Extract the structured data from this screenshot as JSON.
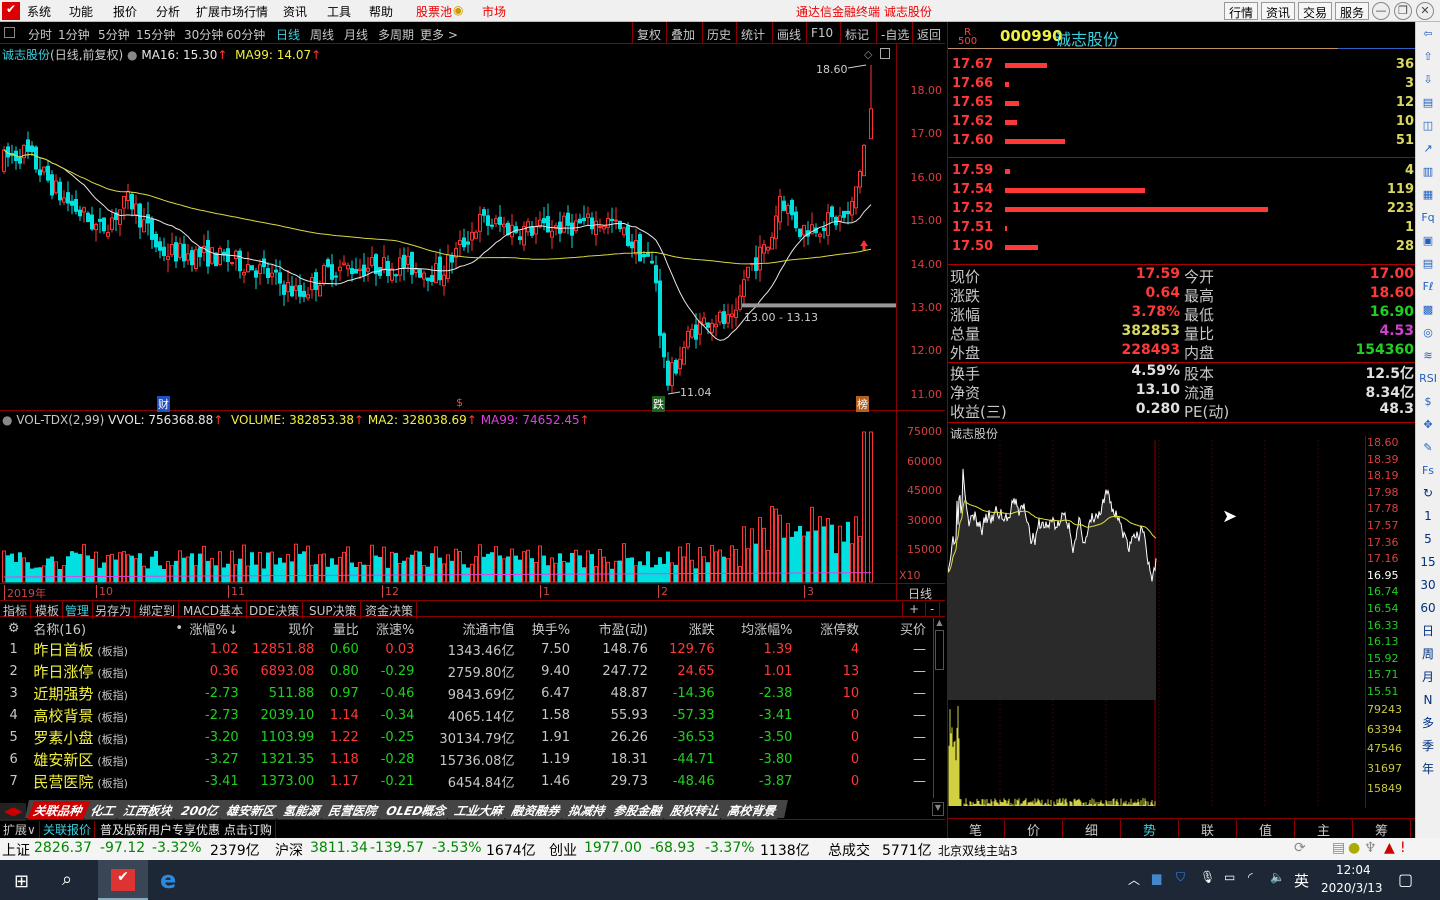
{
  "app": {
    "title": "通达信金融终端 诚志股份",
    "menu": [
      "系统",
      "功能",
      "报价",
      "分析",
      "扩展市场行情",
      "资讯",
      "工具",
      "帮助"
    ],
    "stock_pool": "股票池",
    "market": "市场",
    "top_buttons": [
      "行情",
      "资讯",
      "交易",
      "服务"
    ]
  },
  "periods": {
    "items": [
      "分时",
      "1分钟",
      "5分钟",
      "15分钟",
      "30分钟",
      "60分钟",
      "日线",
      "周线",
      "月线",
      "多周期",
      "更多 >"
    ],
    "selected": "日线"
  },
  "chart_tools": [
    "复权",
    "叠加",
    "历史",
    "统计",
    "画线",
    "F10",
    "标记",
    "-自选",
    "返回"
  ],
  "kline": {
    "name": "诚志股份",
    "mode": "(日线,前复权)",
    "ma16": "MA16: 15.30",
    "ma99": "MA99: 14.07",
    "high_label": "18.60",
    "low_label": "11.04",
    "range_label": "13.00 - 13.13",
    "price_ticks": [
      "18.00",
      "17.00",
      "16.00",
      "15.00",
      "14.00",
      "13.00",
      "12.00",
      "11.00"
    ],
    "markers": [
      "财",
      "$",
      "跌",
      "榜"
    ]
  },
  "volume": {
    "name": "VOL-TDX(2,99)",
    "vvol": "VVOL: 756368.88",
    "volume": "VOLUME: 382853.38",
    "ma2": "MA2: 328038.69",
    "ma99": "MA99: 74652.45",
    "ticks": [
      "75000",
      "60000",
      "45000",
      "30000",
      "15000"
    ],
    "unit": "X10"
  },
  "date_axis": {
    "labels": [
      "2019年",
      "10",
      "11",
      "12",
      "1",
      "2",
      "3"
    ],
    "period": "日线"
  },
  "indicator_tabs": [
    "指标",
    "模板",
    "管理",
    "另存为",
    "绑定到",
    "MACD基本",
    "DDE决策",
    "SUP决策",
    "资金决策"
  ],
  "table": {
    "headers": [
      "名称(16)",
      "•",
      "涨幅%↓",
      "现价",
      "量比",
      "涨速%",
      "流通市值",
      "换手%",
      "市盈(动)",
      "涨跌",
      "均涨幅%",
      "涨停数",
      "买价"
    ],
    "rows": [
      [
        "1",
        "昨日首板",
        "(板指)",
        "1.02",
        "12851.88",
        "0.60",
        "0.03",
        "1343.46亿",
        "7.50",
        "148.76",
        "129.76",
        "1.39",
        "4",
        "—"
      ],
      [
        "2",
        "昨日涨停",
        "(板指)",
        "0.36",
        "6893.08",
        "0.80",
        "-0.29",
        "2759.80亿",
        "9.40",
        "247.72",
        "24.65",
        "1.01",
        "13",
        "—"
      ],
      [
        "3",
        "近期强势",
        "(板指)",
        "-2.73",
        "511.88",
        "0.97",
        "-0.46",
        "9843.69亿",
        "6.47",
        "48.87",
        "-14.36",
        "-2.38",
        "10",
        "—"
      ],
      [
        "4",
        "高校背景",
        "(板指)",
        "-2.73",
        "2039.10",
        "1.14",
        "-0.34",
        "4065.14亿",
        "1.58",
        "55.93",
        "-57.33",
        "-3.41",
        "0",
        "—"
      ],
      [
        "5",
        "罗素小盘",
        "(板指)",
        "-3.20",
        "1103.99",
        "1.22",
        "-0.25",
        "30134.79亿",
        "1.91",
        "26.26",
        "-36.53",
        "-3.50",
        "0",
        "—"
      ],
      [
        "6",
        "雄安新区",
        "(板指)",
        "-3.27",
        "1321.35",
        "1.18",
        "-0.28",
        "15736.08亿",
        "1.19",
        "18.31",
        "-44.71",
        "-3.80",
        "0",
        "—"
      ],
      [
        "7",
        "民营医院",
        "(板指)",
        "-3.41",
        "1373.00",
        "1.17",
        "-0.21",
        "6454.84亿",
        "1.46",
        "29.73",
        "-48.46",
        "-3.87",
        "0",
        "—"
      ]
    ]
  },
  "bottom_tabs": {
    "items": [
      "关联品种",
      "化工",
      "江西板块",
      "200亿",
      "雄安新区",
      "氢能源",
      "民营医院",
      "OLED概念",
      "工业大麻",
      "融资融券",
      "拟减持",
      "参股金融",
      "股权转让",
      "高校背景"
    ],
    "active": "关联品种"
  },
  "ext_row": {
    "expand": "扩展∨",
    "related": "关联报价",
    "promo": "普及版新用户专享优惠 点击订购"
  },
  "status": {
    "sh": [
      "上证",
      "2826.37",
      "-97.12",
      "-3.32%",
      "2379亿"
    ],
    "hs": [
      "沪深",
      "3811.34",
      "-139.57",
      "-3.53%",
      "1674亿"
    ],
    "cy": [
      "创业",
      "1977.00",
      "-68.93",
      "-3.37%",
      "1138亿"
    ],
    "total": [
      "总成交",
      "5771亿"
    ],
    "server": "北京双线主站3"
  },
  "stock": {
    "badge_top": "R",
    "badge_bottom": "500",
    "code": "000990",
    "name": "诚志股份"
  },
  "orderbook": {
    "asks": [
      [
        "17.67",
        "36"
      ],
      [
        "17.66",
        "3"
      ],
      [
        "17.65",
        "12"
      ],
      [
        "17.62",
        "10"
      ],
      [
        "17.60",
        "51"
      ]
    ],
    "bids": [
      [
        "17.59",
        "4"
      ],
      [
        "17.54",
        "119"
      ],
      [
        "17.52",
        "223"
      ],
      [
        "17.51",
        "1"
      ],
      [
        "17.50",
        "28"
      ]
    ]
  },
  "quote": [
    [
      "现价",
      "17.59",
      "今开",
      "17.00",
      "rd",
      "rd"
    ],
    [
      "涨跌",
      "0.64",
      "最高",
      "18.60",
      "rd",
      "rd"
    ],
    [
      "涨幅",
      "3.78%",
      "最低",
      "16.90",
      "rd",
      "gn"
    ],
    [
      "总量",
      "382853",
      "量比",
      "4.53",
      "yl",
      "mg"
    ],
    [
      "外盘",
      "228493",
      "内盘",
      "154360",
      "rd",
      "gn"
    ],
    [
      "换手",
      "4.59%",
      "股本",
      "12.5亿",
      "wt",
      "wt"
    ],
    [
      "净资",
      "13.10",
      "流通",
      "8.34亿",
      "wt",
      "wt"
    ],
    [
      "收益(三)",
      "0.280",
      "PE(动)",
      "48.3",
      "wt",
      "wt"
    ]
  ],
  "intraday": {
    "title": "诚志股份",
    "price_ticks": [
      "18.60",
      "18.39",
      "18.19",
      "17.98",
      "17.78",
      "17.57",
      "17.36",
      "17.16",
      "16.95",
      "16.74",
      "16.54",
      "16.33",
      "16.13",
      "15.92",
      "15.71",
      "15.51"
    ],
    "vol_ticks": [
      "79243",
      "63394",
      "47546",
      "31697",
      "15849"
    ],
    "tabs": [
      "笔",
      "价",
      "细",
      "势",
      "联",
      "值",
      "主",
      "筹"
    ],
    "active_tab": "势"
  },
  "right_tools": [
    "⇦",
    "⇧",
    "⇩",
    "▤",
    "◫",
    "↗",
    "▥",
    "▦",
    "Fq",
    "▣",
    "▤",
    "Fℓ",
    "▩",
    "◎",
    "≋",
    "RSI",
    "$",
    "✥",
    "✎",
    "Fs",
    "↻",
    "1",
    "5",
    "15",
    "30",
    "60",
    "日",
    "周",
    "月",
    "N",
    "多",
    "季",
    "年"
  ],
  "taskbar": {
    "ime": "英",
    "time": "12:04",
    "date": "2020/3/13"
  }
}
